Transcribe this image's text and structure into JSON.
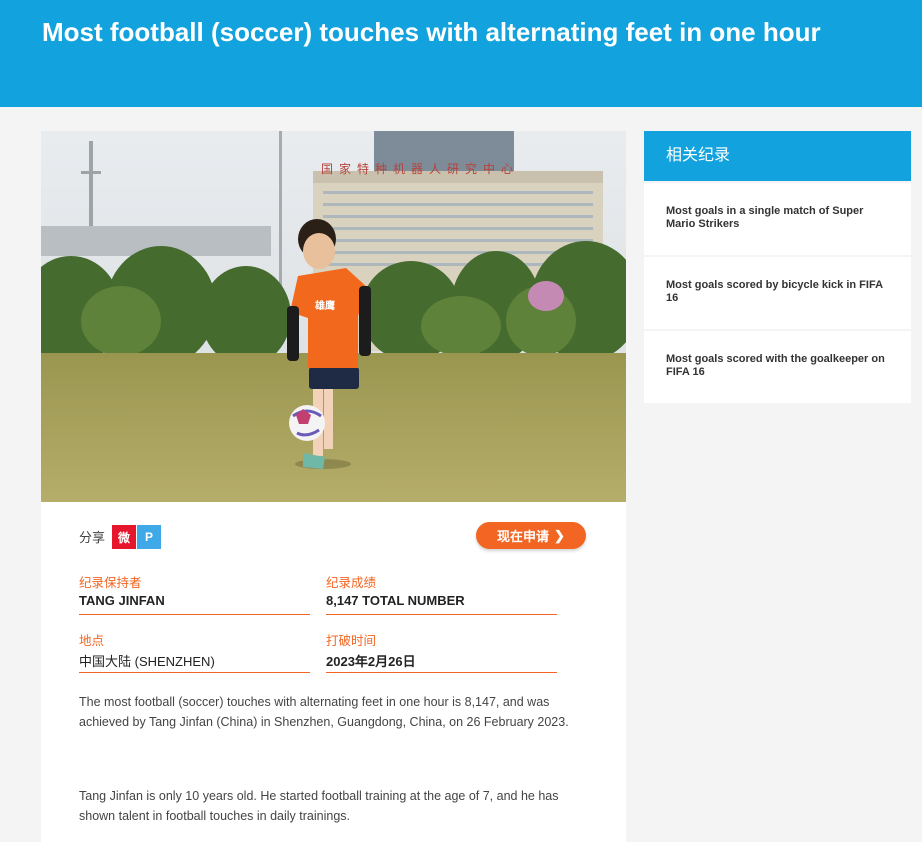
{
  "page": {
    "title": "Most football (soccer) touches with alternating feet in one hour"
  },
  "share": {
    "label": "分享",
    "weibo_icon": "weibo-icon",
    "weibo_glyph": "微",
    "pp_icon": "pengyou-icon",
    "pp_glyph": "P"
  },
  "apply_button": {
    "label": "现在申请",
    "icon": "chevron-right-icon",
    "glyph": "❯"
  },
  "record": {
    "holder_label": "纪录保持者",
    "holder_value": "TANG JINFAN",
    "result_label": "纪录成绩",
    "result_value": "8,147 TOTAL NUMBER",
    "location_label": "地点",
    "location_value": "中国大陆 (SHENZHEN)",
    "date_label": "打破时间",
    "date_value": "2023年2月26日"
  },
  "description": {
    "p1": "The most football (soccer) touches with alternating feet in one hour is 8,147, and was achieved by Tang Jinfan (China) in Shenzhen, Guangdong, China, on 26 February 2023.",
    "p2": "Tang Jinfan is only 10 years old. He started football training at the age of 7, and he has shown talent in football touches in daily trainings."
  },
  "photo": {
    "building_sign": "国家特种机器人研究中心",
    "shirt_text": "雄鹰"
  },
  "sidebar": {
    "title": "相关纪录",
    "items": [
      {
        "label": "Most goals in a single match of Super Mario Strikers"
      },
      {
        "label": "Most goals scored by bicycle kick in FIFA 16"
      },
      {
        "label": "Most goals scored with the goalkeeper on FIFA 16"
      }
    ]
  },
  "colors": {
    "brand_blue": "#12a3de",
    "accent_orange": "#f26522"
  }
}
